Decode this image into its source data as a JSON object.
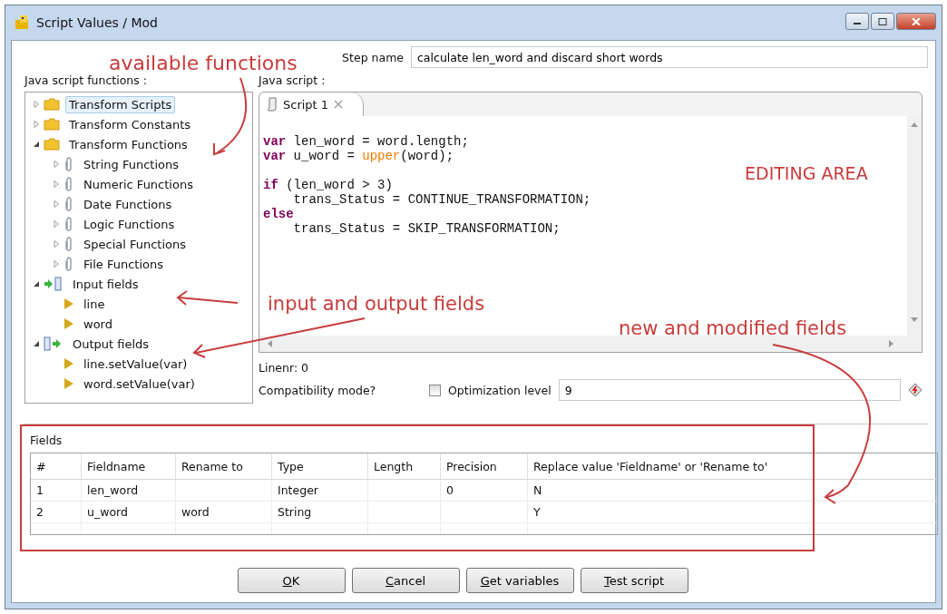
{
  "window": {
    "title": "Script Values / Mod"
  },
  "step_name": {
    "label": "Step name",
    "value": "calculate len_word and discard short words"
  },
  "functions_panel": {
    "label": "Java script functions :",
    "tree": [
      {
        "label": "Transform Scripts",
        "kind": "folder",
        "expanded": false,
        "selected": true
      },
      {
        "label": "Transform Constants",
        "kind": "folder",
        "expanded": false,
        "selected": false
      },
      {
        "label": "Transform Functions",
        "kind": "folder",
        "expanded": true,
        "selected": false,
        "children": [
          {
            "label": "String Functions",
            "kind": "clip",
            "expanded": false,
            "selected": false
          },
          {
            "label": "Numeric Functions",
            "kind": "clip",
            "expanded": false,
            "selected": false
          },
          {
            "label": "Date Functions",
            "kind": "clip",
            "expanded": false,
            "selected": false
          },
          {
            "label": "Logic Functions",
            "kind": "clip",
            "expanded": false,
            "selected": false
          },
          {
            "label": "Special Functions",
            "kind": "clip",
            "expanded": false,
            "selected": false
          },
          {
            "label": "File Functions",
            "kind": "clip",
            "expanded": false,
            "selected": false
          }
        ]
      },
      {
        "label": "Input fields",
        "kind": "input",
        "expanded": true,
        "selected": false,
        "children": [
          {
            "label": "line",
            "kind": "field",
            "selected": false
          },
          {
            "label": "word",
            "kind": "field",
            "selected": false
          }
        ]
      },
      {
        "label": "Output fields",
        "kind": "output",
        "expanded": true,
        "selected": false,
        "children": [
          {
            "label": "line.setValue(var)",
            "kind": "field",
            "selected": false
          },
          {
            "label": "word.setValue(var)",
            "kind": "field",
            "selected": false
          }
        ]
      }
    ]
  },
  "script_panel": {
    "label": "Java script :",
    "tabs": [
      {
        "label": "Script 1",
        "selected": true
      }
    ],
    "code": [
      {
        "tokens": [
          {
            "kind": "keyword",
            "text": "var"
          },
          {
            "kind": "plain",
            "text": " len_word = word.length;"
          }
        ]
      },
      {
        "tokens": [
          {
            "kind": "keyword",
            "text": "var"
          },
          {
            "kind": "plain",
            "text": " u_word = "
          },
          {
            "kind": "function",
            "text": "upper"
          },
          {
            "kind": "plain",
            "text": "(word);"
          }
        ]
      },
      {
        "gap_before": true,
        "tokens": [
          {
            "kind": "keyword",
            "text": "if"
          },
          {
            "kind": "plain",
            "text": " (len_word > 3)"
          }
        ]
      },
      {
        "tokens": [
          {
            "kind": "plain",
            "text": "    trans_Status = CONTINUE_TRANSFORMATION;"
          }
        ]
      },
      {
        "tokens": [
          {
            "kind": "keyword",
            "text": "else"
          }
        ]
      },
      {
        "tokens": [
          {
            "kind": "plain",
            "text": "    trans_Status = SKIP_TRANSFORMATION;"
          }
        ]
      }
    ],
    "line_number": "Linenr: 0"
  },
  "compatibility": {
    "label": "Compatibility mode?",
    "checked": false
  },
  "optimization": {
    "label": "Optimization level",
    "value": "9"
  },
  "fields": {
    "label": "Fields",
    "columns": [
      "#",
      "Fieldname",
      "Rename to",
      "Type",
      "Length",
      "Precision",
      "Replace value 'Fieldname' or 'Rename to'"
    ],
    "rows": [
      [
        "1",
        "len_word",
        "",
        "Integer",
        "",
        "0",
        "N"
      ],
      [
        "2",
        "u_word",
        "word",
        "String",
        "",
        "",
        "Y"
      ]
    ]
  },
  "buttons": [
    "OK",
    "Cancel",
    "Get variables",
    "Test script"
  ],
  "annotations": [
    "available functions",
    "EDITING AREA",
    "input and output fields",
    "new and modified fields"
  ]
}
